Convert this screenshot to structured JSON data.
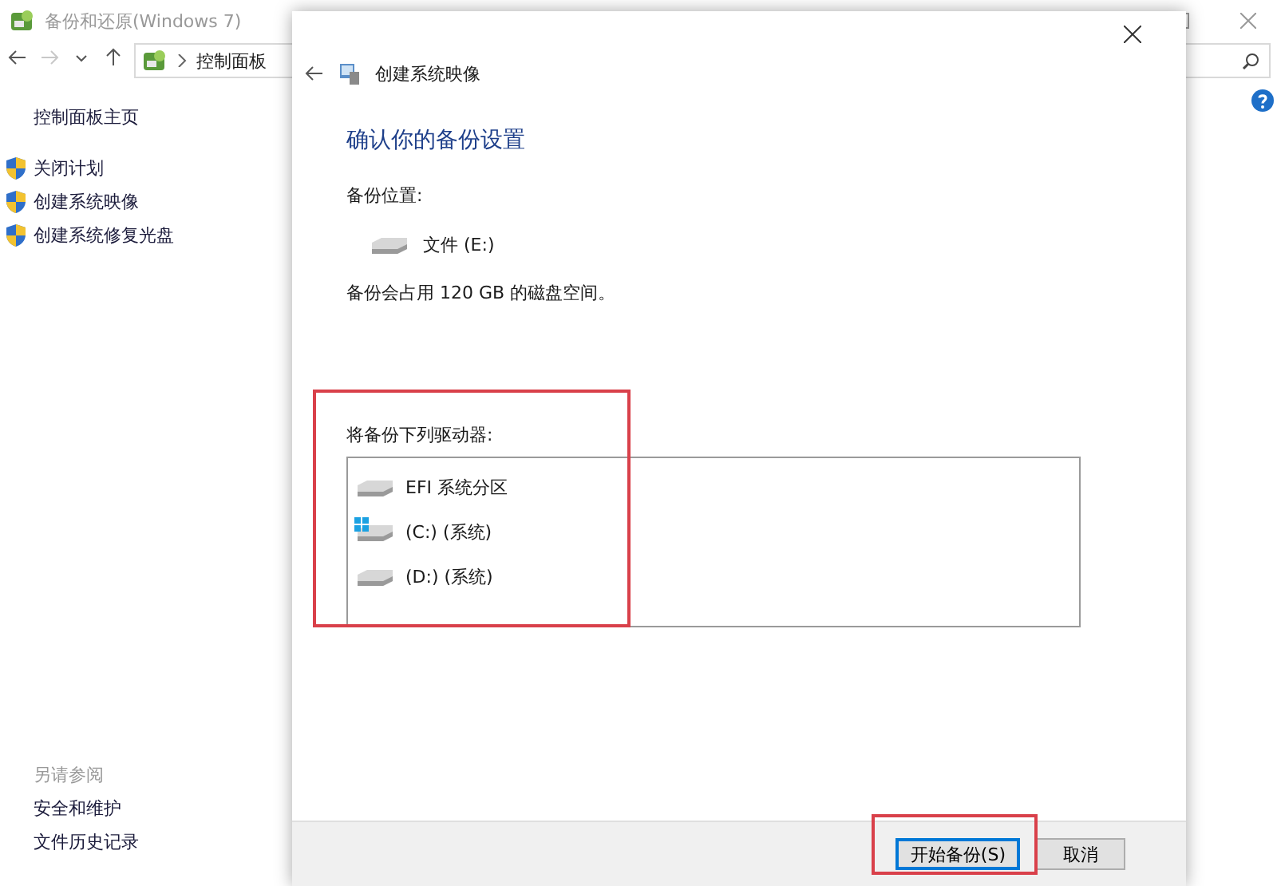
{
  "window": {
    "title": "备份和还原(Windows 7)",
    "controls": [
      {
        "kind": "maximize"
      },
      {
        "kind": "close"
      }
    ]
  },
  "nav": {
    "buttons": [
      {
        "kind": "back",
        "disabled": false
      },
      {
        "kind": "forward",
        "disabled": true
      },
      {
        "kind": "recent",
        "disabled": false
      },
      {
        "kind": "up",
        "disabled": false
      }
    ],
    "breadcrumb": [
      "控制面板"
    ]
  },
  "sidebar": {
    "home": "控制面板主页",
    "tasks": [
      "关闭计划",
      "创建系统映像",
      "创建系统修复光盘"
    ],
    "see_also_title": "另请参阅",
    "see_also": [
      "安全和维护",
      "文件历史记录"
    ]
  },
  "dialog": {
    "title": "创建系统映像",
    "heading": "确认你的备份设置",
    "location_label": "备份位置:",
    "location_drive": "文件 (E:)",
    "space_note": "备份会占用 120 GB 的磁盘空间。",
    "drives_label": "将备份下列驱动器:",
    "drives": [
      {
        "name": "EFI 系统分区",
        "kind": "drive"
      },
      {
        "name": "(C:) (系统)",
        "kind": "system"
      },
      {
        "name": "(D:) (系统)",
        "kind": "drive"
      }
    ],
    "buttons": [
      {
        "label": "开始备份(S)",
        "default": true
      },
      {
        "label": "取消",
        "default": false
      }
    ]
  }
}
